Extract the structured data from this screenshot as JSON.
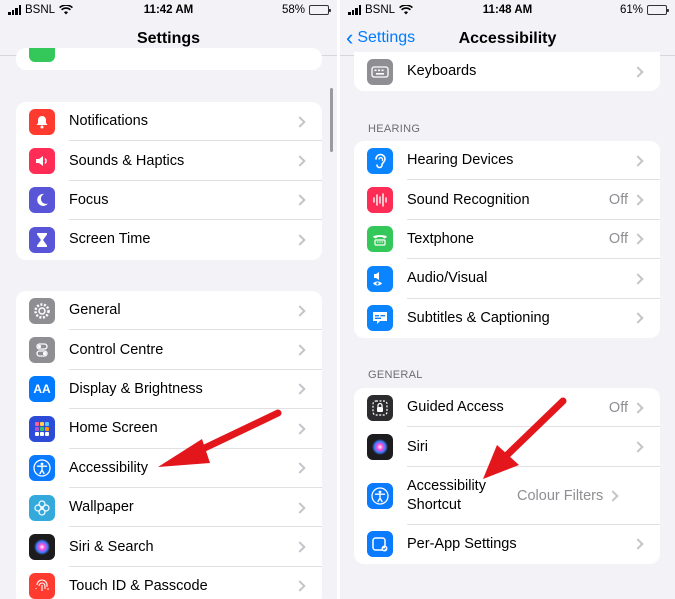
{
  "left": {
    "status": {
      "carrier": "BSNL",
      "time": "11:42 AM",
      "battery": "58%",
      "battery_level": 0.58
    },
    "nav": {
      "title": "Settings"
    },
    "group1": [
      {
        "label": "Notifications",
        "icon": "bell-icon",
        "color": "#ff3b30"
      },
      {
        "label": "Sounds & Haptics",
        "icon": "speaker-icon",
        "color": "#ff2d55"
      },
      {
        "label": "Focus",
        "icon": "moon-icon",
        "color": "#5856d6"
      },
      {
        "label": "Screen Time",
        "icon": "hourglass-icon",
        "color": "#5856d6"
      }
    ],
    "group2": [
      {
        "label": "General",
        "icon": "gear-icon",
        "color": "#8e8e93"
      },
      {
        "label": "Control Centre",
        "icon": "toggles-icon",
        "color": "#8e8e93"
      },
      {
        "label": "Display & Brightness",
        "icon": "text-size-icon",
        "color": "#007aff"
      },
      {
        "label": "Home Screen",
        "icon": "grid-icon",
        "color": "#2c4bd8"
      },
      {
        "label": "Accessibility",
        "icon": "accessibility-icon",
        "color": "#0a7aff"
      },
      {
        "label": "Wallpaper",
        "icon": "flower-icon",
        "color": "#34aadc"
      },
      {
        "label": "Siri & Search",
        "icon": "siri-icon",
        "color": "#1c1c1e"
      },
      {
        "label": "Touch ID & Passcode",
        "icon": "fingerprint-icon",
        "color": "#ff3b30"
      }
    ]
  },
  "right": {
    "status": {
      "carrier": "BSNL",
      "time": "11:48 AM",
      "battery": "61%",
      "battery_level": 0.61
    },
    "nav": {
      "back_label": "Settings",
      "title": "Accessibility"
    },
    "top_row": {
      "label": "Keyboards",
      "icon": "keyboard-icon",
      "color": "#8e8e93"
    },
    "hearing_header": "HEARING",
    "hearing": [
      {
        "label": "Hearing Devices",
        "value": "",
        "icon": "ear-icon",
        "color": "#0a84ff"
      },
      {
        "label": "Sound Recognition",
        "value": "Off",
        "icon": "waveform-icon",
        "color": "#ff2d55"
      },
      {
        "label": "Textphone",
        "value": "Off",
        "icon": "tty-icon",
        "color": "#34c759"
      },
      {
        "label": "Audio/Visual",
        "value": "",
        "icon": "speaker-eye-icon",
        "color": "#0a84ff"
      },
      {
        "label": "Subtitles & Captioning",
        "value": "",
        "icon": "caption-icon",
        "color": "#0a84ff"
      }
    ],
    "general_header": "GENERAL",
    "general": [
      {
        "label": "Guided Access",
        "value": "Off",
        "icon": "lock-icon",
        "color": "#2c2c2e"
      },
      {
        "label": "Siri",
        "value": "",
        "icon": "siri-icon",
        "color": "#1c1c1e"
      },
      {
        "label": "Accessibility Shortcut",
        "value": "Colour Filters",
        "icon": "accessibility-icon",
        "color": "#0a7aff"
      },
      {
        "label": "Per-App Settings",
        "value": "",
        "icon": "app-settings-icon",
        "color": "#0a7aff"
      }
    ]
  },
  "annotation_color": "#e3161c"
}
